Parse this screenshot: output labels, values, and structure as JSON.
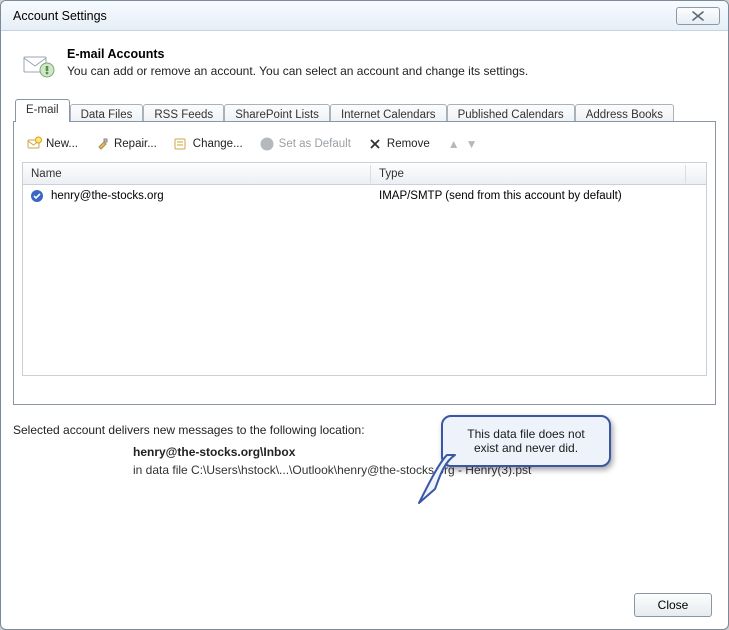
{
  "window": {
    "title": "Account Settings"
  },
  "header": {
    "title": "E-mail Accounts",
    "subtitle": "You can add or remove an account. You can select an account and change its settings."
  },
  "tabs": [
    {
      "label": "E-mail",
      "active": true
    },
    {
      "label": "Data Files"
    },
    {
      "label": "RSS Feeds"
    },
    {
      "label": "SharePoint Lists"
    },
    {
      "label": "Internet Calendars"
    },
    {
      "label": "Published Calendars"
    },
    {
      "label": "Address Books"
    }
  ],
  "toolbar": {
    "new_label": "New...",
    "repair_label": "Repair...",
    "change_label": "Change...",
    "set_default_label": "Set as Default",
    "remove_label": "Remove"
  },
  "table": {
    "columns": {
      "name": "Name",
      "type": "Type"
    },
    "rows": [
      {
        "name": "henry@the-stocks.org",
        "type": "IMAP/SMTP (send from this account by default)"
      }
    ]
  },
  "delivery": {
    "intro": "Selected account delivers new messages to the following location:",
    "location_bold": "henry@the-stocks.org\\Inbox",
    "path": "in data file C:\\Users\\hstock\\...\\Outlook\\henry@the-stocks.org - Henry(3).pst"
  },
  "callout": {
    "text": "This data file does not exist and never did."
  },
  "footer": {
    "close_label": "Close"
  }
}
